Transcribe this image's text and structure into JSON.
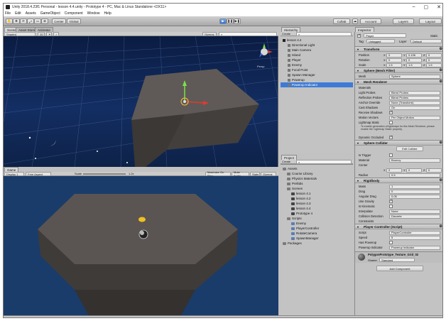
{
  "window": {
    "title": "Unity 2018.4.23f1 Personal - lesson 4.4.unity - Prototype 4 - PC, Mac & Linux Standalone <DX11>"
  },
  "menu": [
    "File",
    "Edit",
    "Assets",
    "GameObject",
    "Component",
    "Window",
    "Help"
  ],
  "toolbar": {
    "center": "Center",
    "global": "Global",
    "collab": "Collab",
    "account": "Account",
    "layers": "Layers",
    "layout": "Layout"
  },
  "scene": {
    "tabs": [
      "Scene",
      "Asset Store",
      "Animator"
    ],
    "shaded": "Shaded",
    "mode_2d": "2D",
    "gizmos": "Gizmos",
    "persp": "Persp"
  },
  "game": {
    "tab": "Game",
    "display": "Display 1",
    "aspect": "Free Aspect",
    "scale_label": "Scale",
    "scale_value": "1.2x",
    "options": [
      "Maximize On Play",
      "Mute Audio",
      "Stats",
      "Gizmos"
    ]
  },
  "hierarchy": {
    "tab": "Hierarchy",
    "create": "Create",
    "items": [
      {
        "label": "lesson 4.4",
        "indent": 0,
        "selected": false
      },
      {
        "label": "Directional Light",
        "indent": 1,
        "selected": false
      },
      {
        "label": "Main Camera",
        "indent": 1,
        "selected": false
      },
      {
        "label": "Island",
        "indent": 1,
        "selected": false
      },
      {
        "label": "Player",
        "indent": 1,
        "selected": false
      },
      {
        "label": "Enemy",
        "indent": 1,
        "selected": false
      },
      {
        "label": "Focal Point",
        "indent": 1,
        "selected": false
      },
      {
        "label": "Spawn Manager",
        "indent": 1,
        "selected": false
      },
      {
        "label": "Powerup",
        "indent": 1,
        "selected": false
      },
      {
        "label": "Powerup Indicator",
        "indent": 1,
        "selected": true
      }
    ]
  },
  "project": {
    "tab": "Project",
    "create": "Create",
    "items": [
      {
        "label": "Assets",
        "indent": 0,
        "kind": "folder"
      },
      {
        "label": "Course Library",
        "indent": 1,
        "kind": "folder"
      },
      {
        "label": "Physics Materials",
        "indent": 1,
        "kind": "folder"
      },
      {
        "label": "Prefabs",
        "indent": 1,
        "kind": "folder"
      },
      {
        "label": "Scenes",
        "indent": 1,
        "kind": "folder"
      },
      {
        "label": "lesson 4.1",
        "indent": 2,
        "kind": "scene"
      },
      {
        "label": "lesson 4.2",
        "indent": 2,
        "kind": "scene"
      },
      {
        "label": "lesson 4.3",
        "indent": 2,
        "kind": "scene"
      },
      {
        "label": "lesson 4.4",
        "indent": 2,
        "kind": "scene"
      },
      {
        "label": "Prototype 4",
        "indent": 2,
        "kind": "scene"
      },
      {
        "label": "Scripts",
        "indent": 1,
        "kind": "folder"
      },
      {
        "label": "Enemy",
        "indent": 2,
        "kind": "script"
      },
      {
        "label": "PlayerController",
        "indent": 2,
        "kind": "script"
      },
      {
        "label": "RotateCamera",
        "indent": 2,
        "kind": "script"
      },
      {
        "label": "SpawnManager",
        "indent": 2,
        "kind": "script"
      },
      {
        "label": "Packages",
        "indent": 0,
        "kind": "folder"
      }
    ]
  },
  "inspector": {
    "tab": "Inspector",
    "object_name": "Player",
    "static": "Static",
    "tag_label": "Tag",
    "tag_value": "Untagged",
    "layer_label": "Layer",
    "layer_value": "Default",
    "transform": {
      "header": "Transform",
      "rows": [
        {
          "label": "Position",
          "x": "0",
          "y": "0.196",
          "z": "0"
        },
        {
          "label": "Rotation",
          "x": "0",
          "y": "0",
          "z": "0"
        },
        {
          "label": "Scale",
          "x": "1.5",
          "y": "1.5",
          "z": "1.5"
        }
      ]
    },
    "mesh_filter": {
      "header": "Sphere (Mesh Filter)",
      "mesh_label": "Mesh",
      "mesh_value": "Sphere"
    },
    "mesh_renderer": {
      "header": "Mesh Renderer",
      "rows": [
        {
          "label": "Materials",
          "value": ""
        },
        {
          "label": "Light Probes",
          "value": "Blend Probes"
        },
        {
          "label": "Reflection Probes",
          "value": "Blend Probes"
        },
        {
          "label": "Anchor Override",
          "value": "None (Transform)"
        },
        {
          "label": "Cast Shadows",
          "value": "On"
        },
        {
          "label": "Receive Shadows",
          "value": ""
        },
        {
          "label": "Motion Vectors",
          "value": "Per Object Motion"
        },
        {
          "label": "Lightmap Static",
          "value": ""
        }
      ],
      "note": "To enable generation of lightmaps for this Mesh Renderer, please enable the 'Lightmap Static' property.",
      "dynamic_occluded": "Dynamic Occluded"
    },
    "sphere_collider": {
      "header": "Sphere Collider",
      "edit": "Edit Collider",
      "rows": [
        {
          "label": "Is Trigger",
          "value": ""
        },
        {
          "label": "Material",
          "value": "Bouncy"
        },
        {
          "label": "Center",
          "value": ""
        },
        {
          "label": "Radius",
          "value": "0.5"
        }
      ],
      "center": {
        "x": "0",
        "y": "0",
        "z": "0"
      }
    },
    "rigidbody": {
      "header": "Rigidbody",
      "rows": [
        {
          "label": "Mass",
          "value": "1"
        },
        {
          "label": "Drag",
          "value": "0"
        },
        {
          "label": "Angular Drag",
          "value": "0.05"
        },
        {
          "label": "Use Gravity",
          "value": ""
        },
        {
          "label": "Is Kinematic",
          "value": ""
        },
        {
          "label": "Interpolate",
          "value": "None"
        },
        {
          "label": "Collision Detection",
          "value": "Discrete"
        },
        {
          "label": "Constraints",
          "value": ""
        }
      ]
    },
    "player_controller": {
      "header": "Player Controller (Script)",
      "rows": [
        {
          "label": "Script",
          "value": "PlayerController"
        },
        {
          "label": "Speed",
          "value": "5"
        },
        {
          "label": "Has Powerup",
          "value": ""
        },
        {
          "label": "Powerup Indicator",
          "value": "Powerup Indicator"
        }
      ]
    },
    "material": {
      "name": "PolygonPrototype_Texture_Grid_02",
      "shader_label": "Shader",
      "shader_value": "Standard"
    },
    "add_component": "Add Component"
  },
  "colors": {
    "accent": "#3d7bd6",
    "scene_sky": "#132e63",
    "island": "#5a5553"
  }
}
